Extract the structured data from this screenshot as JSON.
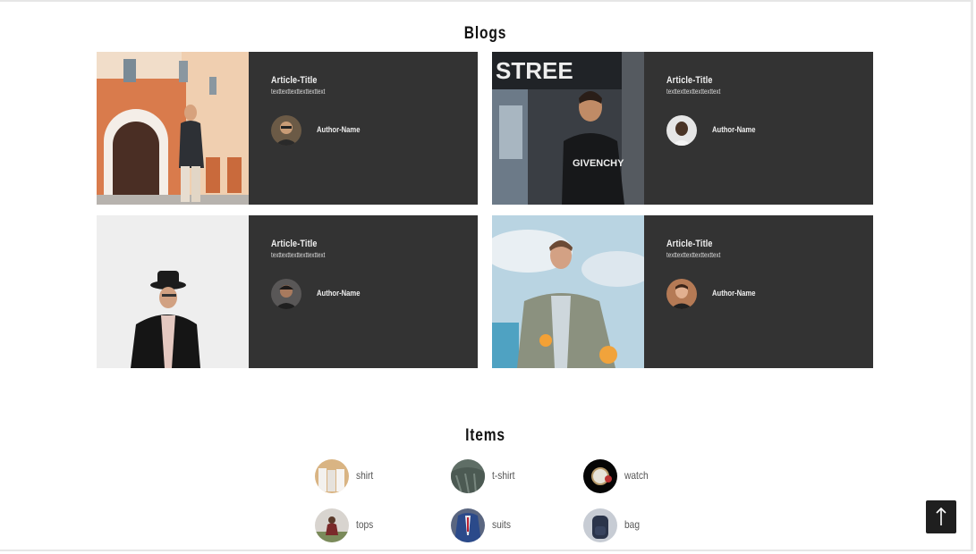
{
  "blogs": {
    "heading": "Blogs",
    "cards": [
      {
        "title": "Article-Title",
        "text": "texttexttexttexttexttext",
        "author": "Author-Name",
        "photo": "man-walking-orange-building-photo",
        "avatar": "author-avatar-sunglasses"
      },
      {
        "title": "Article-Title",
        "text": "texttexttexttexttexttext",
        "author": "Author-Name",
        "photo": "man-givenchy-sweater-street-photo",
        "avatar": "author-avatar-smiling"
      },
      {
        "title": "Article-Title",
        "text": "texttexttexttexttexttext",
        "author": "Author-Name",
        "photo": "man-hat-leather-jacket-photo",
        "avatar": "author-avatar-dark"
      },
      {
        "title": "Article-Title",
        "text": "texttexttexttexttexttext",
        "author": "Author-Name",
        "photo": "man-grey-suit-sky-photo",
        "avatar": "author-avatar-portrait"
      }
    ]
  },
  "items": {
    "heading": "Items",
    "list": [
      {
        "label": "shirt",
        "icon": "shirt-thumb"
      },
      {
        "label": "t-shirt",
        "icon": "tshirt-thumb"
      },
      {
        "label": "watch",
        "icon": "watch-thumb"
      },
      {
        "label": "tops",
        "icon": "tops-thumb"
      },
      {
        "label": "suits",
        "icon": "suits-thumb"
      },
      {
        "label": "bag",
        "icon": "bag-thumb"
      }
    ]
  },
  "scroll_top": {
    "icon": "arrow-up-icon"
  },
  "colors": {
    "card_bg": "#333333",
    "button_bg": "#1f1f1f",
    "text_dark": "#111111",
    "text_item": "#555555"
  }
}
